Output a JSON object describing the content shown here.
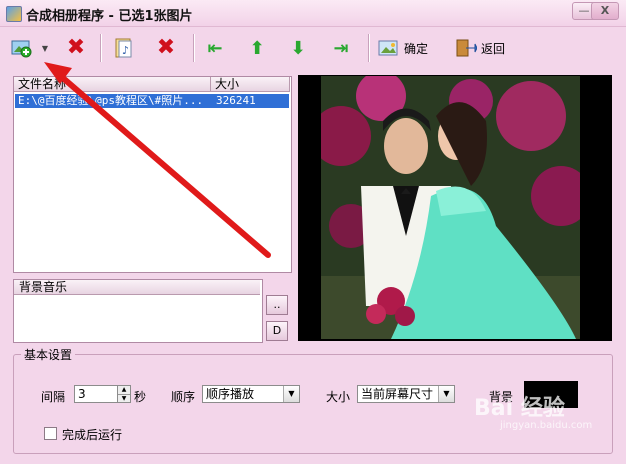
{
  "window": {
    "title": "合成相册程序 - 已选1张图片",
    "minimize": "—",
    "close": "X"
  },
  "toolbar": {
    "ok_label": "确定",
    "back_label": "返回"
  },
  "file_list": {
    "columns": [
      "文件名称",
      "大小"
    ],
    "rows": [
      {
        "name": "E:\\@百度经验\\@ps教程区\\#照片...",
        "size": "326241"
      }
    ]
  },
  "music": {
    "header": "背景音乐",
    "browse": "..",
    "delete": "D"
  },
  "settings": {
    "legend": "基本设置",
    "interval_label": "间隔",
    "interval_value": "3",
    "interval_unit": "秒",
    "order_label": "顺序",
    "order_value": "顺序播放",
    "size_label": "大小",
    "size_value": "当前屏幕尺寸",
    "bg_label": "背景",
    "bg_color": "#000000",
    "run_after_label": "完成后运行"
  },
  "watermark": {
    "text": "Bai 经验",
    "sub": "jingyan.baidu.com"
  },
  "colors": {
    "accent_arrow": "#e01a1a",
    "selection": "#2f6fd6",
    "window_bg": "#f3d6ea"
  }
}
